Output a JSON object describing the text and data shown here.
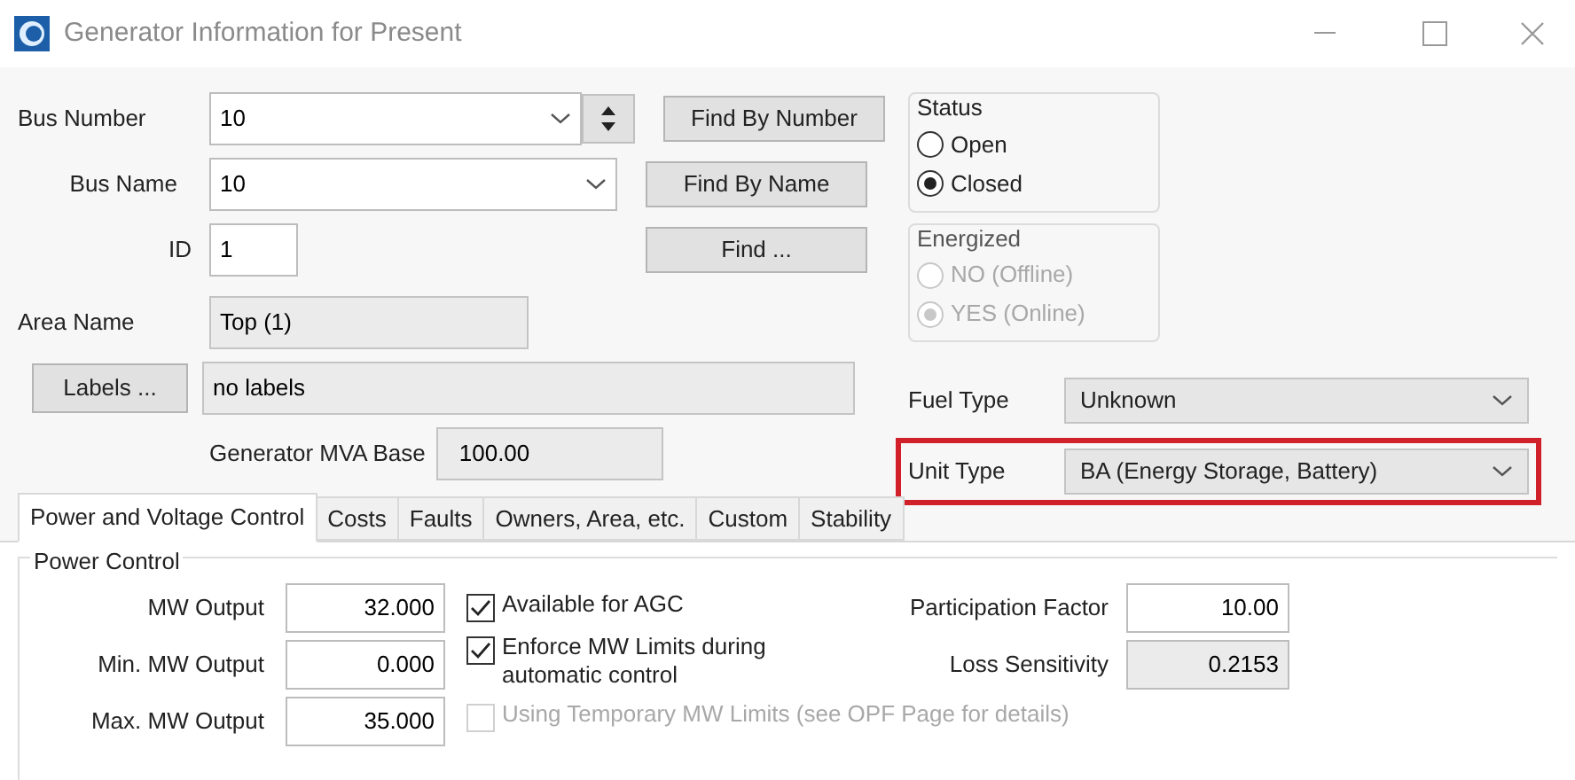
{
  "window": {
    "title": "Generator Information for Present"
  },
  "bus_number": {
    "label": "Bus Number",
    "value": "10",
    "button": "Find By Number"
  },
  "bus_name": {
    "label": "Bus Name",
    "value": "10",
    "button": "Find By Name"
  },
  "id": {
    "label": "ID",
    "value": "1",
    "button": "Find ..."
  },
  "area_name": {
    "label": "Area Name",
    "value": "Top (1)"
  },
  "labels": {
    "button": "Labels ...",
    "value": "no labels"
  },
  "mva_base": {
    "label": "Generator MVA Base",
    "value": "100.00"
  },
  "status": {
    "title": "Status",
    "disabled": false,
    "options": [
      {
        "label": "Open",
        "selected": false
      },
      {
        "label": "Closed",
        "selected": true
      }
    ]
  },
  "energized": {
    "title": "Energized",
    "disabled": true,
    "options": [
      {
        "label": "NO (Offline)",
        "selected": false
      },
      {
        "label": "YES (Online)",
        "selected": true
      }
    ]
  },
  "fuel_type": {
    "label": "Fuel Type",
    "value": "Unknown",
    "highlighted": false
  },
  "unit_type": {
    "label": "Unit Type",
    "value": "BA (Energy Storage, Battery)",
    "highlighted": true
  },
  "tabs": [
    {
      "label": "Power and Voltage Control",
      "selected": true
    },
    {
      "label": "Costs",
      "selected": false
    },
    {
      "label": "Faults",
      "selected": false
    },
    {
      "label": "Owners, Area, etc.",
      "selected": false
    },
    {
      "label": "Custom",
      "selected": false
    },
    {
      "label": "Stability",
      "selected": false
    }
  ],
  "power_control": {
    "title": "Power Control",
    "fields": [
      {
        "label": "MW Output",
        "value": "32.000"
      },
      {
        "label": "Min. MW Output",
        "value": "0.000"
      },
      {
        "label": "Max. MW Output",
        "value": "35.000"
      }
    ],
    "checks": [
      {
        "label": "Available for AGC",
        "checked": true,
        "disabled": false
      },
      {
        "label": "Enforce MW Limits during automatic control",
        "checked": true,
        "disabled": false
      },
      {
        "label": "Using Temporary MW Limits (see OPF Page for details)",
        "checked": false,
        "disabled": true
      }
    ],
    "right_fields": [
      {
        "label": "Participation Factor",
        "value": "10.00",
        "readonly": false
      },
      {
        "label": "Loss Sensitivity",
        "value": "0.2153",
        "readonly": true
      }
    ]
  }
}
